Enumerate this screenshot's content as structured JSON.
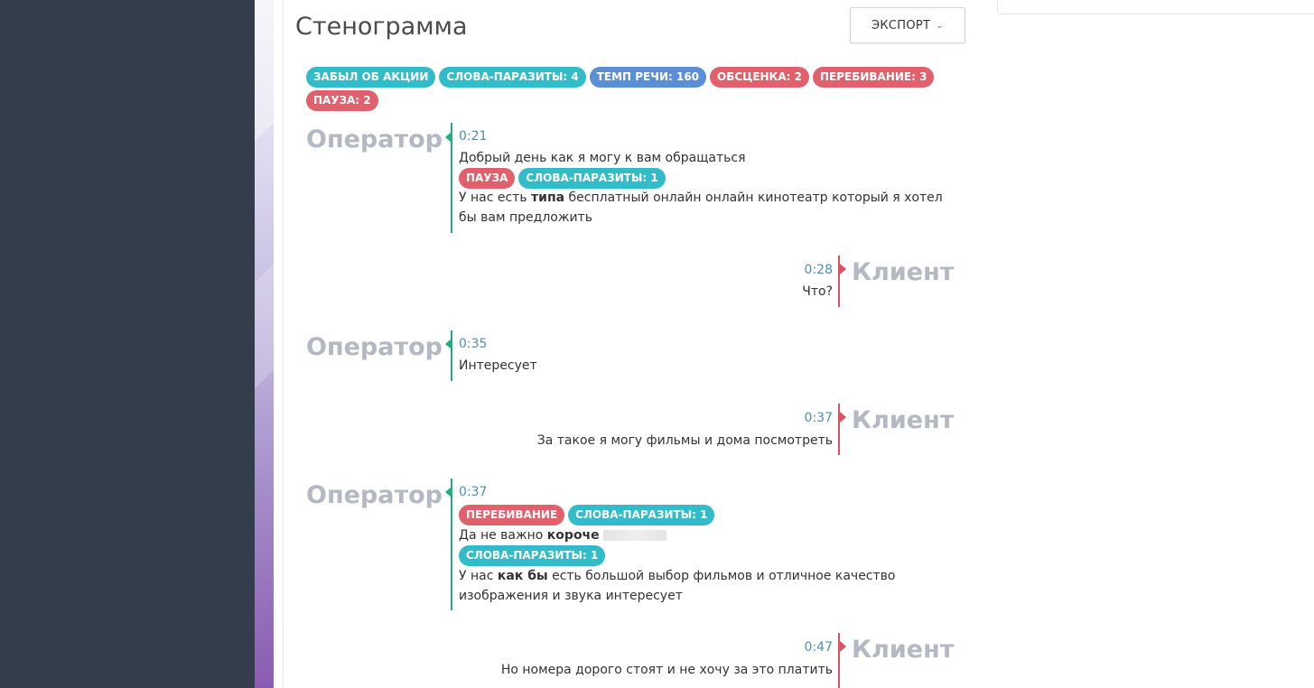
{
  "title": "Стенограмма",
  "export": {
    "label": "ЭКСПОРТ"
  },
  "summary_tags_row1": [
    {
      "label": "ЗАБЫЛ ОБ АКЦИИ",
      "color": "#32bcc9"
    },
    {
      "label": "СЛОВА-ПАРАЗИТЫ: 4",
      "color": "#32bcc9"
    },
    {
      "label": "ТЕМП РЕЧИ: 160",
      "color": "#5a8fd6"
    },
    {
      "label": "ОБСЦЕНКА: 2",
      "color": "#e0606b"
    },
    {
      "label": "ПЕРЕБИВАНИЕ: 3",
      "color": "#e0606b"
    }
  ],
  "summary_tags_row2": [
    {
      "label": "ПАУЗА: 2",
      "color": "#e0606b"
    }
  ],
  "messages": {
    "m1": {
      "speaker": "Оператор",
      "time": "0:21",
      "line1": "Добрый день как я могу к вам обращаться",
      "tag1": "ПАУЗА",
      "tag2": "СЛОВА-ПАРАЗИТЫ: 1",
      "line2_pre": "У нас есть ",
      "line2_bold": "типа",
      "line2_post": " бесплатный онлайн онлайн кинотеатр который я хотел",
      "line3": "бы вам предложить"
    },
    "m2": {
      "speaker": "Клиент",
      "time": "0:28",
      "line1": "Что?"
    },
    "m3": {
      "speaker": "Оператор",
      "time": "0:35",
      "line1": "Интересует"
    },
    "m4": {
      "speaker": "Клиент",
      "time": "0:37",
      "line1": "За такое я могу фильмы и дома посмотреть"
    },
    "m5": {
      "speaker": "Оператор",
      "time": "0:37",
      "tag1": "ПЕРЕБИВАНИЕ",
      "tag2": "СЛОВА-ПАРАЗИТЫ: 1",
      "line1_pre": "Да не важно ",
      "line1_bold": "короче",
      "tag3": "СЛОВА-ПАРАЗИТЫ: 1",
      "line2_pre": "У нас ",
      "line2_bold": "как бы",
      "line2_post": " есть большой выбор фильмов и отличное качество",
      "line3": "изображения и звука интересует"
    },
    "m6": {
      "speaker": "Клиент",
      "time": "0:47",
      "line1": "Но номера дорого стоят и не хочу за это платить"
    }
  },
  "colors": {
    "operator": "#1fae86",
    "client": "#e0505e",
    "time": "#4d8fb5",
    "speaker": "#b3b8c2",
    "sidebar": "#333d4b"
  }
}
